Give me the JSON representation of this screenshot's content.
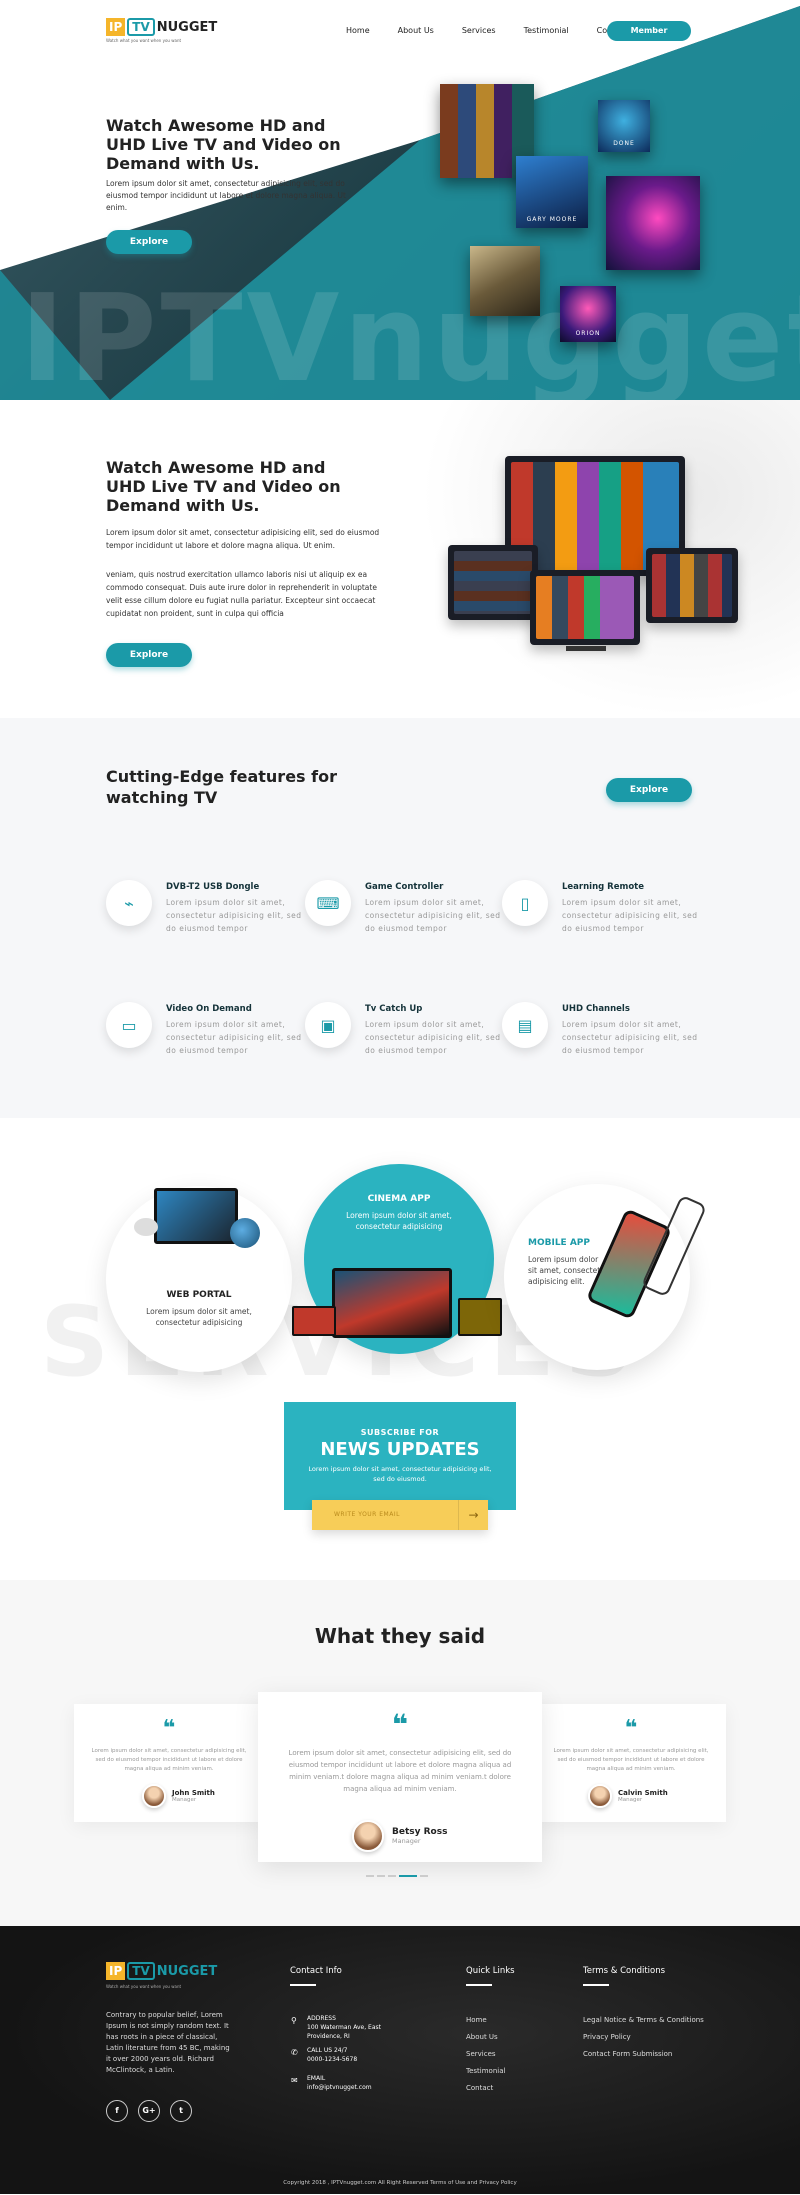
{
  "header": {
    "logo": {
      "ip": "IP",
      "tv": "TV",
      "nugget": "NUGGET",
      "tagline": "Watch what you want when you want"
    },
    "nav": [
      "Home",
      "About Us",
      "Services",
      "Testimonial",
      "Contact"
    ],
    "member_label": "Member"
  },
  "hero": {
    "title": "Watch Awesome HD and UHD Live TV and Video on Demand with Us.",
    "text": "Lorem ipsum dolor sit amet, consectetur adipisicing elit, sed do eiusmod tempor incididunt ut labore et dolore magna aliqua. Ut enim.",
    "button": "Explore",
    "watermark": "IPTVnugget",
    "posters": [
      "",
      "DONE",
      "GARY MOORE",
      "",
      "",
      "ORION"
    ]
  },
  "intro": {
    "title": "Watch Awesome HD and UHD Live TV and Video on Demand with Us.",
    "para1": "Lorem ipsum dolor sit amet, consectetur adipisicing elit, sed do eiusmod tempor incididunt ut labore et dolore magna aliqua. Ut enim.",
    "para2": "veniam, quis nostrud exercitation ullamco laboris nisi ut aliquip ex ea commodo consequat. Duis aute irure dolor in reprehenderit in voluptate velit esse cillum dolore eu fugiat nulla pariatur. Excepteur sint occaecat cupidatat non proident, sunt in culpa qui officia",
    "button": "Explore"
  },
  "features": {
    "title": "Cutting-Edge features for watching TV",
    "button": "Explore",
    "items": [
      {
        "name": "DVB-T2 USB Dongle",
        "desc": "Lorem ipsum dolor sit amet, consectetur adipisicing elit, sed do eiusmod tempor",
        "icon": "usb-dongle-icon"
      },
      {
        "name": "Game Controller",
        "desc": "Lorem ipsum dolor sit amet, consectetur adipisicing elit, sed do eiusmod tempor",
        "icon": "game-controller-icon"
      },
      {
        "name": "Learning Remote",
        "desc": "Lorem ipsum dolor sit amet, consectetur adipisicing elit, sed do eiusmod tempor",
        "icon": "remote-icon"
      },
      {
        "name": "Video On Demand",
        "desc": "Lorem ipsum dolor sit amet, consectetur adipisicing elit, sed do eiusmod tempor",
        "icon": "video-demand-icon"
      },
      {
        "name": "Tv Catch Up",
        "desc": "Lorem ipsum dolor sit amet, consectetur adipisicing elit, sed do eiusmod tempor",
        "icon": "tv-catchup-icon"
      },
      {
        "name": "UHD Channels",
        "desc": "Lorem ipsum dolor sit amet, consectetur adipisicing elit, sed do eiusmod tempor",
        "icon": "uhd-icon"
      }
    ]
  },
  "services": {
    "watermark": "SERVICES",
    "web": {
      "title": "WEB PORTAL",
      "desc": "Lorem ipsum dolor sit amet, consectetur adipisicing"
    },
    "cinema": {
      "title": "CINEMA APP",
      "desc": "Lorem ipsum dolor sit amet, consectetur adipisicing"
    },
    "mobile": {
      "title": "MOBILE APP",
      "desc": "Lorem ipsum dolor sit amet, consectetur adipisicing elit."
    }
  },
  "subscribe": {
    "small": "SUBSCRIBE FOR",
    "big": "NEWS UPDATES",
    "desc": "Lorem ipsum dolor sit amet, consectetur adipisicing elit, sed do eiusmod.",
    "placeholder": "WRITE YOUR EMAIL"
  },
  "testimonials": {
    "title": "What they said",
    "cards": [
      {
        "text": "Lorem ipsum dolor sit amet, consectetur adipisicing elit, sed do eiusmod tempor incididunt ut labore et dolore magna aliqua ad minim veniam.",
        "name": "John Smith",
        "role": "Manager"
      },
      {
        "text": "Lorem ipsum dolor sit amet, consectetur adipisicing elit, sed do eiusmod tempor incididunt ut labore et dolore magna aliqua ad minim veniam.t dolore magna aliqua ad minim veniam.t dolore magna aliqua ad minim veniam.",
        "name": "Betsy Ross",
        "role": "Manager"
      },
      {
        "text": "Lorem ipsum dolor sit amet, consectetur adipisicing elit, sed do eiusmod tempor incididunt ut labore et dolore magna aliqua ad minim veniam.",
        "name": "Calvin Smith",
        "role": "Manager"
      }
    ]
  },
  "footer": {
    "about": "Contrary to popular belief, Lorem Ipsum is not simply random text. It has roots in a piece of classical, Latin literature from 45 BC, making it over 2000 years old. Richard McClintock, a Latin.",
    "socials": [
      "f",
      "G+",
      "t"
    ],
    "contact_title": "Contact Info",
    "address_label": "ADDRESS",
    "address": "100 Waterman Ave, East Providence, RI",
    "phone_label": "CALL US 24/7",
    "phone": "0000-1234-5678",
    "email_label": "EMAIL",
    "email": "info@iptvnugget.com",
    "quick_title": "Quick Links",
    "quick_links": [
      "Home",
      "About Us",
      "Services",
      "Testimonial",
      "Contact"
    ],
    "terms_title": "Terms & Conditions",
    "terms_links": [
      "Legal Notice & Terms & Conditions",
      "Privacy Policy",
      "Contact Form Submission"
    ],
    "copyright": "Copyright 2018 , IPTVnugget.com All Right Reserved Terms of Use and Privacy Policy"
  }
}
